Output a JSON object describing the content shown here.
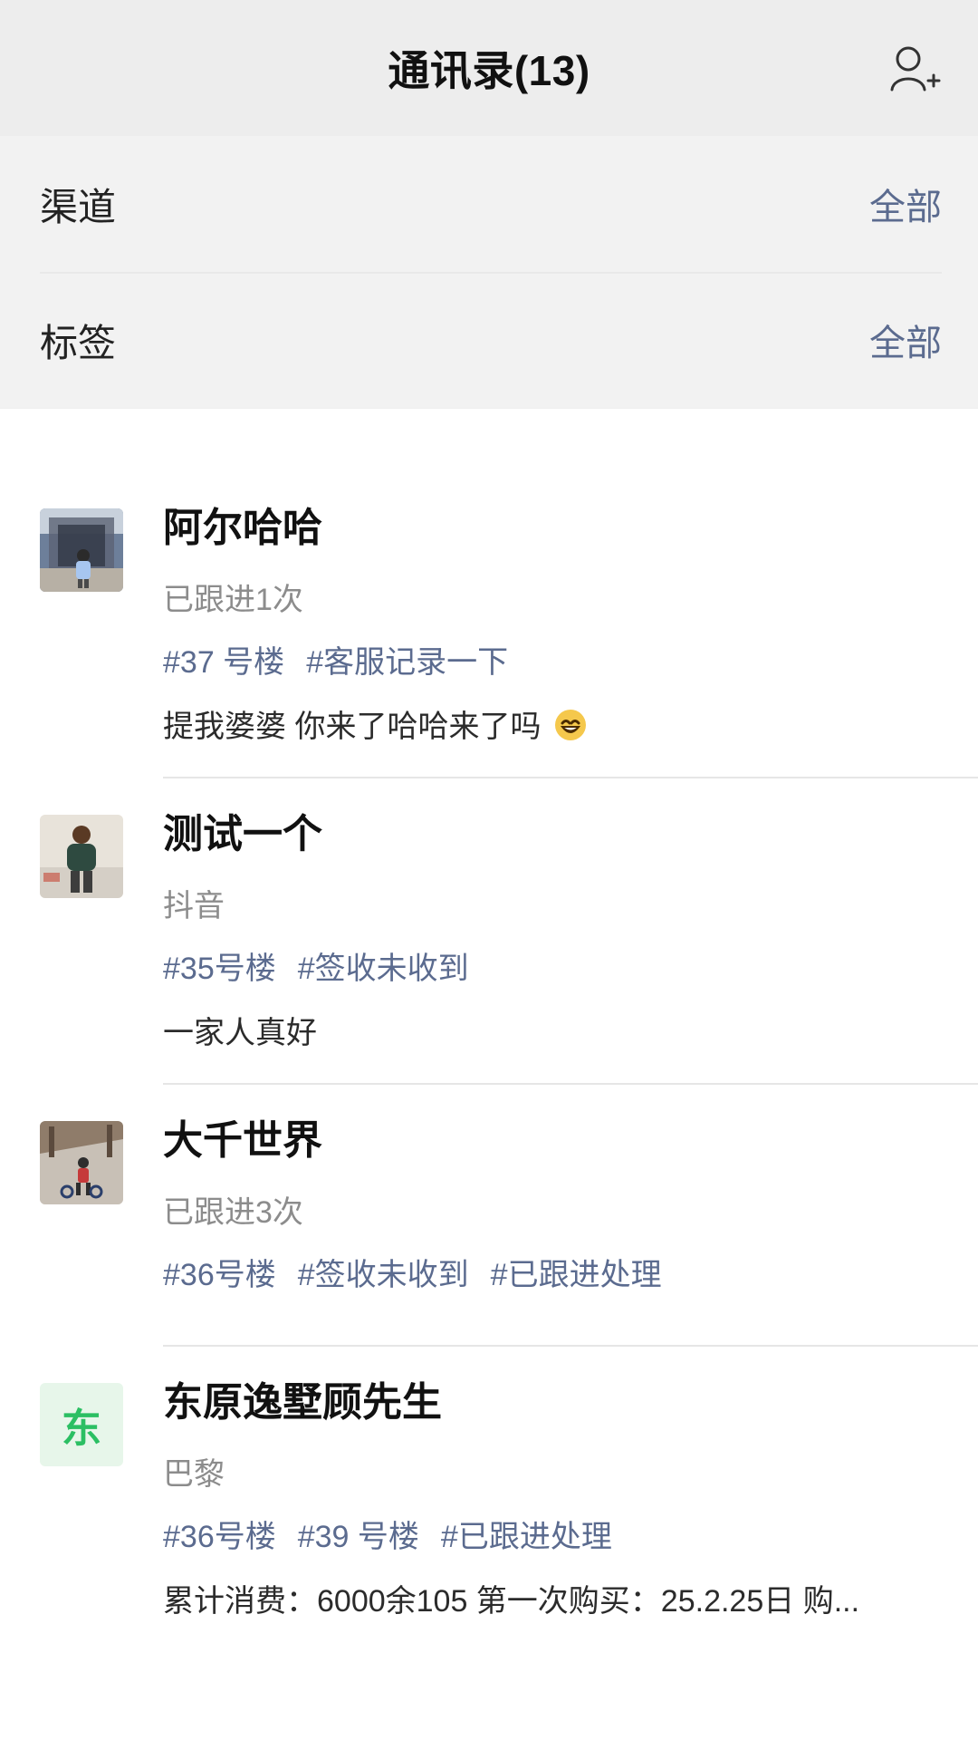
{
  "header": {
    "title": "通讯录(13)",
    "add_icon": "add-user-icon"
  },
  "filters": [
    {
      "label": "渠道",
      "value": "全部"
    },
    {
      "label": "标签",
      "value": "全部"
    }
  ],
  "contacts": [
    {
      "name": "阿尔哈哈",
      "meta": "已跟进1次",
      "tags": [
        "#37 号楼",
        "#客服记录一下"
      ],
      "note": "提我婆婆 你来了哈哈来了吗",
      "note_emoji": "grinning-face-emoji"
    },
    {
      "name": "测试一个",
      "meta": "抖音",
      "tags": [
        "#35号楼",
        "#签收未收到"
      ],
      "note": "一家人真好"
    },
    {
      "name": "大千世界",
      "meta": "已跟进3次",
      "tags": [
        "#36号楼",
        "#签收未收到",
        "#已跟进处理"
      ],
      "note": ""
    },
    {
      "name": "东原逸墅顾先生",
      "avatar_letter": "东",
      "meta": "巴黎",
      "tags": [
        "#36号楼",
        "#39 号楼",
        "#已跟进处理"
      ],
      "note": "累计消费：6000余105 第一次购买：25.2.25日 购..."
    }
  ],
  "colors": {
    "link": "#5b6b8f",
    "muted": "#8c8c8c",
    "avatar_green": "#2bbf63"
  }
}
